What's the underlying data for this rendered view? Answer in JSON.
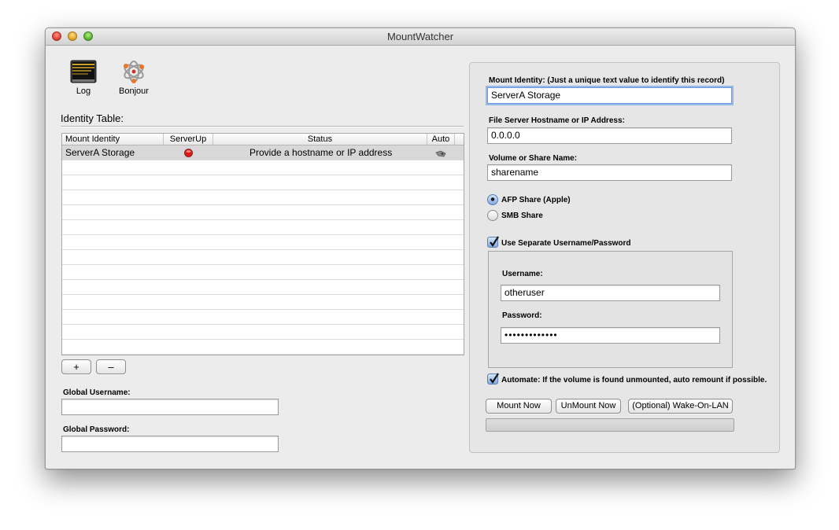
{
  "window": {
    "title": "MountWatcher"
  },
  "toolbar": {
    "log_label": "Log",
    "bonjour_label": "Bonjour"
  },
  "identity_table": {
    "heading": "Identity Table:",
    "columns": [
      "Mount Identity",
      "ServerUp",
      "Status",
      "Auto"
    ],
    "rows": [
      {
        "mount_identity": "ServerA Storage",
        "server_up": "down",
        "status": "Provide a hostname or IP address",
        "auto": "on"
      }
    ]
  },
  "table_buttons": {
    "add": "+",
    "remove": "–"
  },
  "global": {
    "username_label": "Global Username:",
    "username_value": "",
    "password_label": "Global Password:",
    "password_value": ""
  },
  "detail": {
    "mount_identity_label": "Mount Identity:  (Just a unique text value to identify this record)",
    "mount_identity_value": "ServerA Storage",
    "host_label": "File Server Hostname or IP Address:",
    "host_value": "0.0.0.0",
    "share_label": "Volume or Share Name:",
    "share_value": "sharename",
    "afp_label": "AFP Share (Apple)",
    "smb_label": "SMB Share",
    "share_type_selected": "AFP",
    "separate_credentials_label": "Use Separate Username/Password",
    "separate_credentials_checked": true,
    "username_label": "Username:",
    "username_value": "otheruser",
    "password_label": "Password:",
    "password_mask": "•••••••••••••",
    "automate_label": "Automate: If the volume is found unmounted, auto remount if possible.",
    "automate_checked": true,
    "mount_now": "Mount Now",
    "unmount_now": "UnMount Now",
    "wake_on_lan": "(Optional) Wake-On-LAN",
    "progress": 0
  },
  "colors": {
    "status_red": "#d61b1b",
    "focus_ring": "#94b9ed",
    "selected_row": "#d8d8d8"
  },
  "icons": {
    "log": "console-log-icon",
    "bonjour": "bonjour-icon",
    "server_up": "red-status-dot-icon",
    "auto": "auto-remount-icon"
  }
}
